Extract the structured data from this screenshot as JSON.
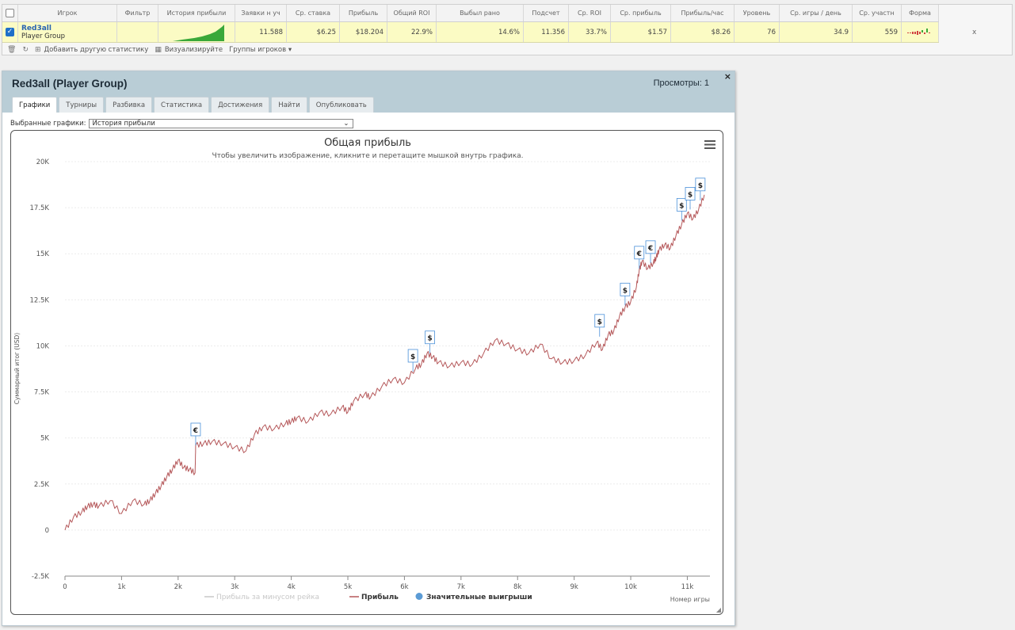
{
  "table": {
    "headers": [
      "",
      "Игрок",
      "Фильтр",
      "История прибыли",
      "Заявки н уч",
      "Ср. ставка",
      "Прибыль",
      "Общий ROI",
      "Выбыл рано",
      "Подсчет",
      "Ср. ROI",
      "Ср. прибыль",
      "Прибыль/час",
      "Уровень",
      "Ср. игры / день",
      "Ср. участн",
      "Форма"
    ],
    "row": {
      "player_name": "Red3all",
      "player_group": "Player Group",
      "filter": "",
      "entries": "11.588",
      "avg_stake": "$6.25",
      "profit": "$18.204",
      "total_roi": "22.9%",
      "early_out": "14.6%",
      "count": "11.356",
      "avg_roi": "33.7%",
      "avg_profit": "$1.57",
      "profit_per_hour": "$8.26",
      "level": "76",
      "games_per_day": "34.9",
      "avg_entrants": "559",
      "extra": "x"
    }
  },
  "toolbar": {
    "add_stat": "Добавить другую статистику",
    "visualize": "Визуализируйте",
    "groups": "Группы игроков ▾"
  },
  "panel": {
    "title": "Red3all (Player Group)",
    "views": "Просмотры: 1",
    "close": "×",
    "tabs": [
      "Графики",
      "Турниры",
      "Разбивка",
      "Статистика",
      "Достижения",
      "Найти",
      "Опубликовать"
    ],
    "selected_label": "Выбранные графики:",
    "selected_value": "История прибыли"
  },
  "chart_data": {
    "type": "line",
    "title": "Общая прибыль",
    "subtitle": "Чтобы увеличить изображение, кликните и перетащите мышкой внутрь графика.",
    "ylabel": "Суммарный итог (USD)",
    "xlabel": "Номер игры",
    "xlim": [
      0,
      11400
    ],
    "ylim": [
      -2500,
      20000
    ],
    "x_ticks": [
      "0",
      "1k",
      "2k",
      "3k",
      "4k",
      "5k",
      "6k",
      "7k",
      "8k",
      "9k",
      "10k",
      "11k"
    ],
    "y_ticks": [
      "-2.5K",
      "0",
      "2.5K",
      "5K",
      "7.5K",
      "10K",
      "12.5K",
      "15K",
      "17.5K",
      "20K"
    ],
    "legend": [
      "Прибыль за минусом рейка",
      "Прибыль",
      "Значительные выигрыши"
    ],
    "legend_position": "bottom",
    "colors": {
      "line": "#b5585a",
      "accent": "#4a90d9",
      "legend_muted": "#c8c8c8"
    },
    "series": [
      {
        "name": "Прибыль",
        "x": [
          0,
          150,
          300,
          400,
          500,
          600,
          800,
          1000,
          1200,
          1400,
          1500,
          1600,
          1700,
          1800,
          1900,
          2000,
          2100,
          2200,
          2300,
          2310,
          2450,
          2600,
          2800,
          3000,
          3200,
          3350,
          3500,
          3700,
          3900,
          4000,
          4100,
          4300,
          4500,
          4700,
          4900,
          5000,
          5100,
          5300,
          5400,
          5600,
          5800,
          6000,
          6200,
          6300,
          6400,
          6500,
          6600,
          6800,
          7000,
          7200,
          7400,
          7600,
          7800,
          8000,
          8200,
          8400,
          8600,
          8800,
          9000,
          9200,
          9400,
          9500,
          9600,
          9700,
          9800,
          9900,
          10000,
          10100,
          10150,
          10200,
          10300,
          10400,
          10450,
          10500,
          10600,
          10700,
          10800,
          10900,
          11000,
          11100,
          11200,
          11300
        ],
        "y": [
          0,
          700,
          1000,
          1300,
          1400,
          1300,
          1600,
          900,
          1600,
          1400,
          1600,
          2000,
          2400,
          2900,
          3300,
          3800,
          3400,
          3300,
          3100,
          4600,
          4700,
          4800,
          4700,
          4500,
          4300,
          5200,
          5600,
          5500,
          5800,
          5900,
          6100,
          5900,
          6400,
          6300,
          6700,
          6400,
          7000,
          7400,
          7200,
          7800,
          8200,
          8000,
          8800,
          9000,
          9600,
          9400,
          9100,
          8900,
          9100,
          9000,
          9600,
          10300,
          10100,
          9800,
          9600,
          10100,
          9300,
          9100,
          9200,
          9500,
          10200,
          9800,
          10600,
          10800,
          11600,
          12100,
          12400,
          13200,
          14100,
          14600,
          14200,
          14500,
          14800,
          15200,
          15500,
          15300,
          16000,
          16600,
          17200,
          16900,
          17400,
          18200
        ]
      }
    ],
    "big_wins": [
      {
        "x": 2310,
        "y": 4600,
        "symbol": "€"
      },
      {
        "x": 6150,
        "y": 8600,
        "symbol": "$"
      },
      {
        "x": 6450,
        "y": 9600,
        "symbol": "$"
      },
      {
        "x": 9450,
        "y": 10500,
        "symbol": "$"
      },
      {
        "x": 9900,
        "y": 12200,
        "symbol": "$"
      },
      {
        "x": 10150,
        "y": 14200,
        "symbol": "€"
      },
      {
        "x": 10350,
        "y": 14500,
        "symbol": "€"
      },
      {
        "x": 10900,
        "y": 16800,
        "symbol": "$"
      },
      {
        "x": 11050,
        "y": 17400,
        "symbol": "$"
      },
      {
        "x": 11230,
        "y": 17900,
        "symbol": "$"
      }
    ]
  }
}
